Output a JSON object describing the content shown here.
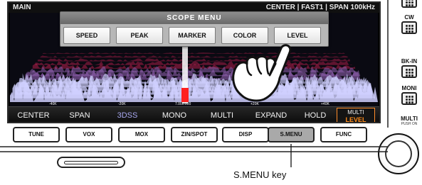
{
  "status": {
    "band": "MAIN",
    "center": "CENTER",
    "mode": "FAST1",
    "span": "SPAN 100kHz"
  },
  "scope_menu": {
    "title": "SCOPE MENU",
    "buttons": [
      "SPEED",
      "PEAK",
      "MARKER",
      "COLOR",
      "LEVEL"
    ]
  },
  "scale": [
    "-40K",
    "-20K",
    "7.000.000",
    "+20K",
    "+40K"
  ],
  "function_bar": {
    "items": [
      "CENTER",
      "SPAN",
      "3DSS",
      "MONO",
      "MULTI",
      "EXPAND",
      "HOLD"
    ],
    "multi_top": "MULTI",
    "multi_bottom": "LEVEL"
  },
  "hardware_keys": [
    "TUNE",
    "VOX",
    "MOX",
    "ZIN/SPOT",
    "DISP",
    "S.MENU",
    "FUNC"
  ],
  "side_keys": [
    {
      "label": "CW",
      "sub": ""
    },
    {
      "label": "BK-IN",
      "sub": ""
    },
    {
      "label": "MONI",
      "sub": ""
    },
    {
      "label": "MULTI",
      "sub": "PUSH ON"
    }
  ],
  "callout": "S.MENU key",
  "colors": {
    "accent": "#ff8c1a",
    "spectrum": "#c8c8ff",
    "peak": "#e0304a"
  }
}
